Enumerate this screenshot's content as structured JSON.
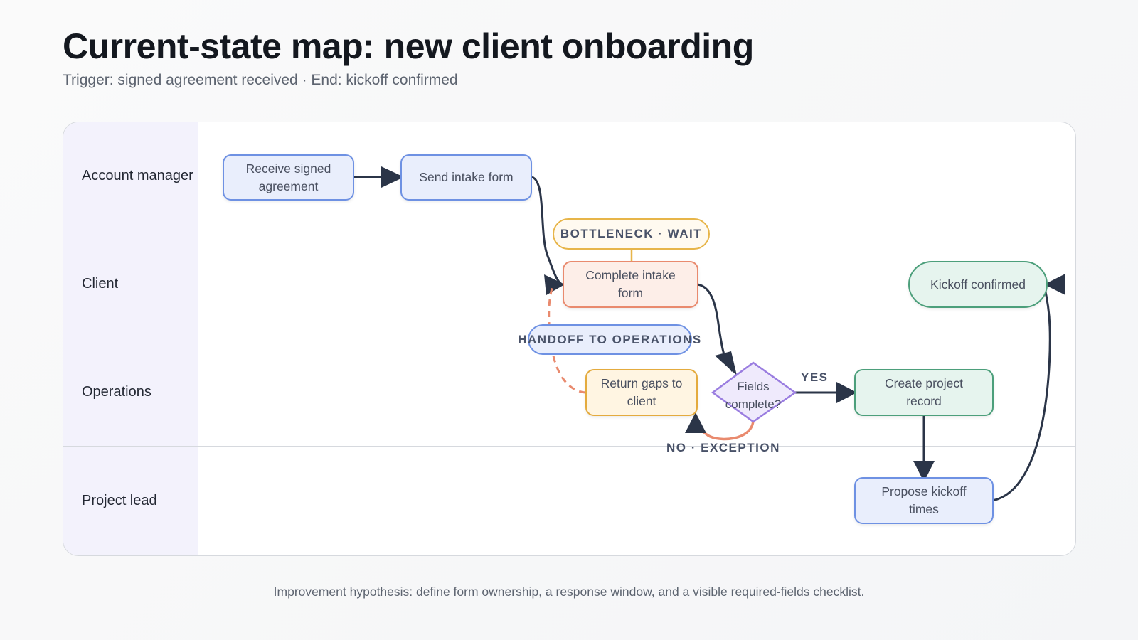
{
  "title": "Current-state map: new client onboarding",
  "subtitle": "Trigger: signed agreement received · End: kickoff confirmed",
  "lanes": [
    "Account manager",
    "Client",
    "Operations",
    "Project lead"
  ],
  "nodes": {
    "receive": "Receive signed agreement",
    "send_form": "Send intake form",
    "complete_form": "Complete intake form",
    "return_gaps": "Return gaps to client",
    "decision": "Fields complete?",
    "create_record": "Create project record",
    "propose_times": "Propose kickoff times",
    "kickoff": "Kickoff confirmed"
  },
  "tags": {
    "bottleneck": "BOTTLENECK · WAIT",
    "handoff": "HANDOFF TO OPERATIONS"
  },
  "edge_labels": {
    "yes": "YES",
    "no": "NO · EXCEPTION"
  },
  "footnote": "Improvement hypothesis: define form ownership, a response window, and a visible required-fields checklist.",
  "colors": {
    "edge": "#2b3548",
    "exception": "#e98a6e",
    "lane_header": "#f3f2fc",
    "bottleneck": "#e7b549",
    "handoff": "#6e91e3",
    "decision": "#9a7de0"
  }
}
